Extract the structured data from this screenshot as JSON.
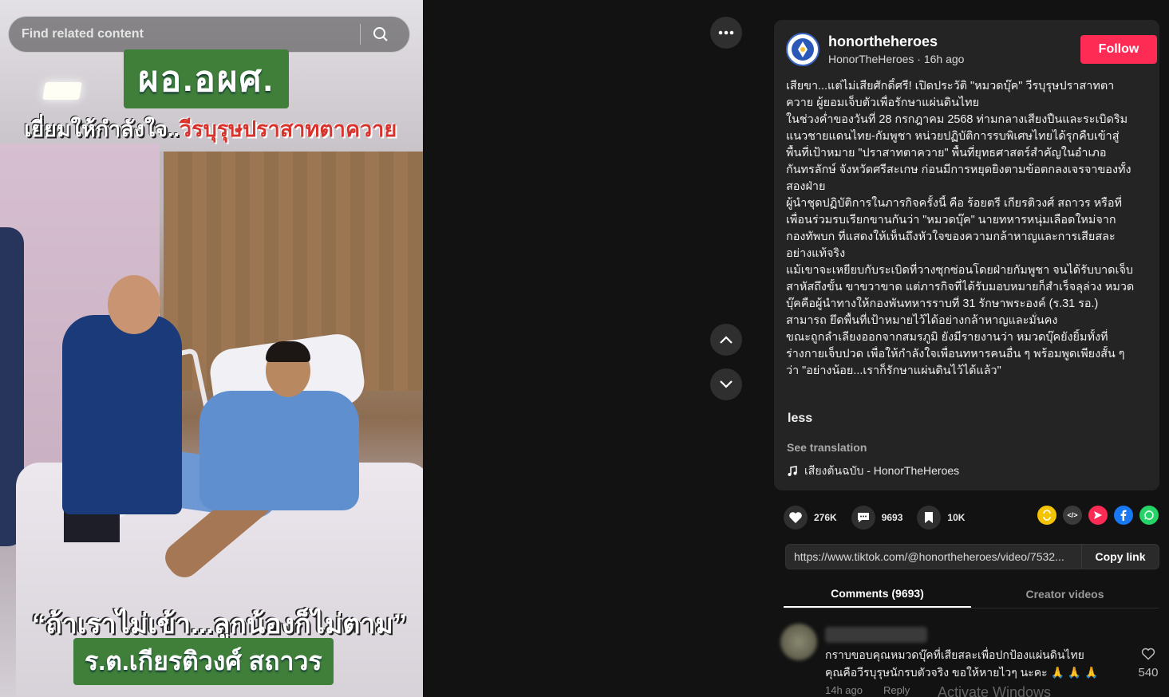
{
  "search": {
    "placeholder": "Find related content"
  },
  "video_captions": {
    "top_title": "ผอ.อผศ.",
    "subtitle_white": "เยี่ยมให้กำลังใจ..",
    "subtitle_red": "วีรบุรุษปราสาทตาควาย",
    "quote": "“ถ้าเราไม่เข้า...ลูกน้องก็ไม่ตาม”",
    "name_caption": "ร.ต.เกียรติวงศ์ สถาวร"
  },
  "icons": {
    "search": "search-icon",
    "more": "more-icon",
    "up": "chevron-up-icon",
    "down": "chevron-down-icon",
    "like": "heart-icon",
    "comment": "comment-icon",
    "save": "bookmark-icon",
    "share": "share-arrow-icon",
    "music": "music-note-icon"
  },
  "author": {
    "username": "honortheheroes",
    "display_name": "HonorTheHeroes",
    "separator": " · ",
    "time_ago": "16h ago",
    "follow_label": "Follow"
  },
  "description": [
    "เสียขา...แต่ไม่เสียศักดิ์ศรี! เปิดประวัติ \"หมวดบุ๊ค\" วีรบุรุษปราสาทตา",
    "ควาย ผู้ยอมเจ็บตัวเพื่อรักษาแผ่นดินไทย",
    "ในช่วงค่ำของวันที่ 28 กรกฎาคม 2568 ท่ามกลางเสียงปืนและระเบิดริม",
    "แนวชายแดนไทย-กัมพูชา หน่วยปฏิบัติการรบพิเศษไทยได้รุกคืบเข้าสู่",
    "พื้นที่เป้าหมาย \"ปราสาทตาควาย\" พื้นที่ยุทธศาสตร์สำคัญในอำเภอ",
    "กันทรลักษ์ จังหวัดศรีสะเกษ ก่อนมีการหยุดยิงตามข้อตกลงเจรจาของทั้ง",
    "สองฝ่าย",
    "ผู้นำชุดปฏิบัติการในภารกิจครั้งนี้ คือ ร้อยตรี เกียรติวงศ์ สถาวร หรือที่",
    "เพื่อนร่วมรบเรียกขานกันว่า \"หมวดบุ๊ค\" นายทหารหนุ่มเลือดใหม่จาก",
    "กองทัพบก ที่แสดงให้เห็นถึงหัวใจของความกล้าหาญและการเสียสละ",
    "อย่างแท้จริง",
    "แม้เขาจะเหยียบกับระเบิดที่วางซุกซ่อนโดยฝ่ายกัมพูชา จนได้รับบาดเจ็บ",
    "สาหัสถึงขั้น ขาขวาขาด แต่ภารกิจที่ได้รับมอบหมายก็สำเร็จลุล่วง หมวด",
    "บุ๊คคือผู้นำทางให้กองพันทหารราบที่ 31 รักษาพระองค์ (ร.31 รอ.)",
    "สามารถ ยึดพื้นที่เป้าหมายไว้ได้อย่างกล้าหาญและมั่นคง",
    "ขณะถูกลำเลียงออกจากสมรภูมิ ยังมีรายงานว่า หมวดบุ๊คยังยิ้มทั้งที่",
    "ร่างกายเจ็บปวด เพื่อให้กำลังใจเพื่อนทหารคนอื่น ๆ พร้อมพูดเพียงสั้น ๆ",
    "ว่า \"อย่างน้อย...เราก็รักษาแผ่นดินไว้ได้แล้ว\""
  ],
  "less_label": "less",
  "see_translation": "See translation",
  "music": "เสียงต้นฉบับ - HonorTheHeroes",
  "stats": {
    "likes": "276K",
    "comments": "9693",
    "saves": "10K"
  },
  "share_colors": {
    "repost": "#f5c400",
    "embed": "#3a3a3a",
    "telegram": "#fe2c55",
    "facebook": "#1877f2",
    "whatsapp": "#25d366"
  },
  "share_labels": {
    "embed": "</>"
  },
  "link": {
    "url": "https://www.tiktok.com/@honortheheroes/video/7532...",
    "copy_label": "Copy link"
  },
  "tabs": [
    {
      "label": "Comments (9693)"
    },
    {
      "label": "Creator videos"
    }
  ],
  "comment": {
    "lines": [
      "กราบขอบคุณหมวดบุ๊คที่เสียสละเพื่อปกป้องแผ่นดินไทย",
      "คุณคือวีรบุรุษนักรบตัวจริง ขอให้หายไวๆ นะคะ 🙏 🙏 🙏"
    ],
    "time": "14h ago",
    "reply_label": "Reply",
    "likes": "540"
  },
  "watermark": "Activate Windows"
}
